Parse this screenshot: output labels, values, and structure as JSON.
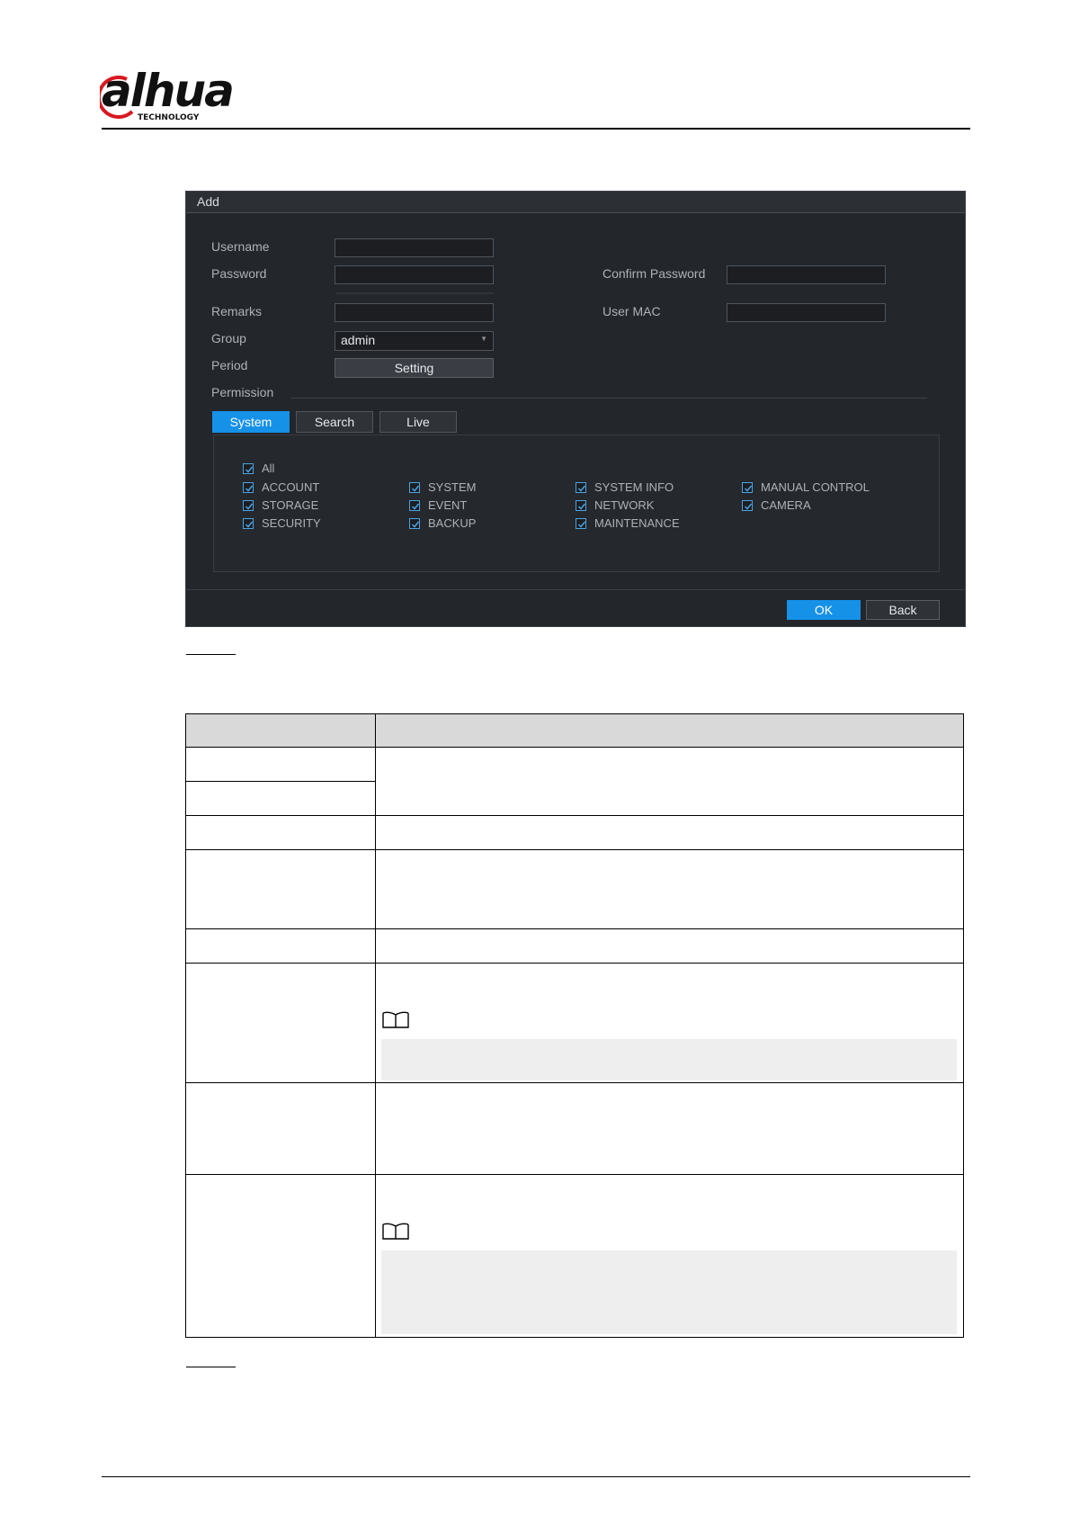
{
  "header": {
    "logo_text": "alhua",
    "logo_sub": "TECHNOLOGY",
    "brand_color": "#d71920"
  },
  "dialog": {
    "title": "Add",
    "labels": {
      "username": "Username",
      "password": "Password",
      "confirm_password": "Confirm Password",
      "remarks": "Remarks",
      "user_mac": "User MAC",
      "group": "Group",
      "period": "Period",
      "permission": "Permission"
    },
    "fields": {
      "username_value": "",
      "password_value": "",
      "confirm_password_value": "",
      "remarks_value": "",
      "user_mac_value": ""
    },
    "group_select": {
      "value": "admin"
    },
    "period_button": "Setting",
    "tabs": [
      {
        "label": "System",
        "active": true
      },
      {
        "label": "Search",
        "active": false
      },
      {
        "label": "Live",
        "active": false
      }
    ],
    "permissions": {
      "all": {
        "label": "All",
        "checked": true
      },
      "items": [
        {
          "label": "ACCOUNT",
          "checked": true
        },
        {
          "label": "SYSTEM",
          "checked": true
        },
        {
          "label": "SYSTEM INFO",
          "checked": true
        },
        {
          "label": "MANUAL CONTROL",
          "checked": true
        },
        {
          "label": "STORAGE",
          "checked": true
        },
        {
          "label": "EVENT",
          "checked": true
        },
        {
          "label": "NETWORK",
          "checked": true
        },
        {
          "label": "CAMERA",
          "checked": true
        },
        {
          "label": "SECURITY",
          "checked": true
        },
        {
          "label": "BACKUP",
          "checked": true
        },
        {
          "label": "MAINTENANCE",
          "checked": true
        }
      ]
    },
    "ok_button": "OK",
    "back_button": "Back",
    "accent_color": "#1591e8"
  }
}
